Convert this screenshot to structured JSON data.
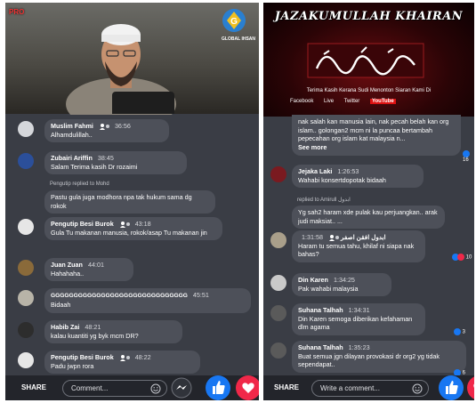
{
  "left": {
    "video": {
      "channel_logo": "PRO",
      "logo_caption": "GLOBAL IHSAN"
    },
    "comments": [
      {
        "name": "Muslim Fahmi",
        "time": "36:56",
        "text": "Alhamdulillah..",
        "badge": true
      },
      {
        "name": "Zubairi Ariffin",
        "time": "38:45",
        "text": "Salam Terima kasih Dr rozaimi"
      },
      {
        "reply_note": "Pengutip replied to Mohd",
        "name": "",
        "time": "",
        "text": "Pastu gula juga modhora npa tak hukum sama dg rokok"
      },
      {
        "name": "Pengutip Besi Burok",
        "time": "43:18",
        "text": "Gula Tu makanan manusia, rokok/asap Tu makanan jin",
        "badge": true
      },
      {
        "name": "Juan Zuan",
        "time": "44:01",
        "text": "Hahahaha.."
      },
      {
        "name": "GGGGGGGGGGGGGGGGGGGGGGGGGGGGGG",
        "time": "45:51",
        "text": "Bidaah"
      },
      {
        "name": "Habib Zai",
        "time": "48:21",
        "text": "kalau kuantiti yg byk mcm DR?"
      },
      {
        "name": "Pengutip Besi Burok",
        "time": "48:22",
        "text": "Padu jwpn rora",
        "badge": true
      }
    ],
    "bottom": {
      "share_label": "SHARE",
      "comment_placeholder": "Comment..."
    }
  },
  "right": {
    "video": {
      "title": "JAZAKUMULLAH KHAIRAN",
      "subtitle": "Terima Kasih Kerana Sudi Menonton Siaran Kami Di",
      "logos": [
        "Facebook",
        "Live",
        "Twitter",
        "YouTube"
      ]
    },
    "comments": [
      {
        "name": "",
        "time": "",
        "text": "nak salah kan manusia lain, nak pecah belah kan org islam.. golongan2 mcm ni la puncaa bertambah pepecahan org islam kat malaysia n...",
        "see_more": "See more",
        "reactions": "16"
      },
      {
        "name": "Jejaka Laki",
        "time": "1:26:53",
        "text": "Wahabi konsertdopotak bidaah"
      },
      {
        "reply_note": "replied to Amirull ابدول",
        "name": "",
        "time": "",
        "text": "Yg sah2 haram xde pulak kau perjuangkan.. arak judi maksiat.. ..."
      },
      {
        "name": "ابدول افقن اصفر",
        "time": "1:31:58",
        "text": "Haram tu semua tahu, khilaf ni siapa nak bahas?",
        "reactions": "10",
        "badge": true
      },
      {
        "name": "Din Karen",
        "time": "1:34:25",
        "text": "Pak wahabi malaysia"
      },
      {
        "name": "Suhana Talhah",
        "time": "1:34:31",
        "text": "Din Karen semoga diberikan kefahaman dlm agama",
        "reactions": "3"
      },
      {
        "name": "Suhana Talhah",
        "time": "1:35:23",
        "text": "Buat semua jgn dilayan provokasi dr org2 yg tidak sependapat..",
        "reactions": "6"
      }
    ],
    "bottom": {
      "share_label": "SHARE",
      "comment_placeholder": "Write a comment..."
    }
  },
  "colors": {
    "facebook_blue": "#1877f2",
    "love_red": "#f02849",
    "bubble": "#4d5059",
    "panel_bg": "#3a3d45"
  }
}
